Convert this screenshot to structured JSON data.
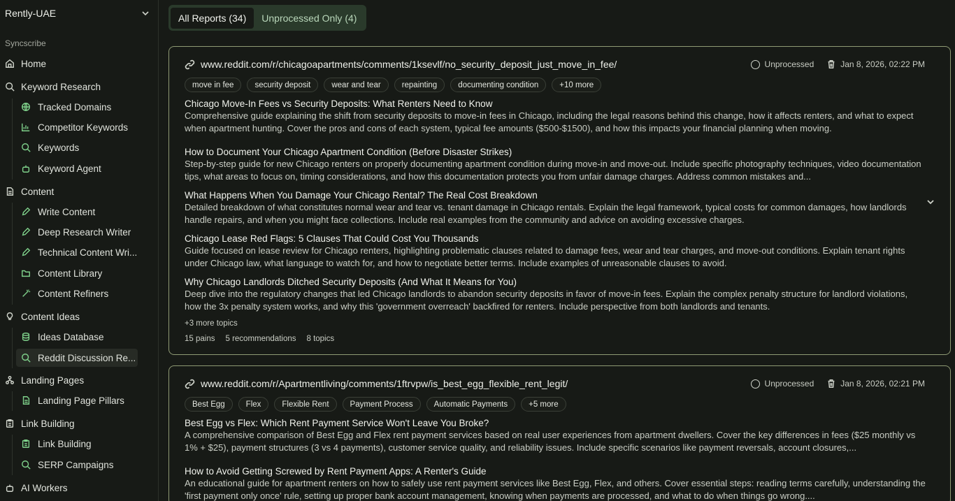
{
  "sidebar": {
    "workspace": "Rently-UAE",
    "section": "Syncscribe",
    "home": "Home",
    "keyword_research": {
      "label": "Keyword Research",
      "items": [
        "Tracked Domains",
        "Competitor Keywords",
        "Keywords",
        "Keyword Agent"
      ]
    },
    "content": {
      "label": "Content",
      "items": [
        "Write Content",
        "Deep Research Writer",
        "Technical Content Wri...",
        "Content Library",
        "Content Refiners"
      ]
    },
    "content_ideas": {
      "label": "Content Ideas",
      "items": [
        "Ideas Database",
        "Reddit Discussion Re..."
      ]
    },
    "landing_pages": {
      "label": "Landing Pages",
      "items": [
        "Landing Page Pillars"
      ]
    },
    "link_building": {
      "label": "Link Building",
      "items": [
        "Link Building",
        "SERP Campaigns"
      ]
    },
    "ai_workers": "AI Workers"
  },
  "tabs": {
    "all": "All Reports (34)",
    "unprocessed": "Unprocessed Only (4)"
  },
  "reports": [
    {
      "url": "www.reddit.com/r/chicagoapartments/comments/1ksevlf/no_security_deposit_just_move_in_fee/",
      "status": "Unprocessed",
      "date": "Jan 8, 2026, 02:22 PM",
      "tags": [
        "move in fee",
        "security deposit",
        "wear and tear",
        "repainting",
        "documenting condition",
        "+10 more"
      ],
      "topics": [
        {
          "title": "Chicago Move-In Fees vs Security Deposits: What Renters Need to Know",
          "desc": "Comprehensive guide explaining the shift from security deposits to move-in fees in Chicago, including the legal reasons behind this change, how it affects renters, and what to expect when apartment hunting. Cover the pros and cons of each system, typical fee amounts ($500-$1500), and how this impacts your financial planning when moving."
        },
        {
          "title": "How to Document Your Chicago Apartment Condition (Before Disaster Strikes)",
          "desc": "Step-by-step guide for new Chicago renters on properly documenting apartment condition during move-in and move-out. Include specific photography techniques, video documentation tips, what areas to focus on, timing considerations, and how this documentation protects you from unfair damage charges. Address common mistakes and..."
        },
        {
          "title": "What Happens When You Damage Your Chicago Rental? The Real Cost Breakdown",
          "desc": "Detailed breakdown of what constitutes normal wear and tear vs. tenant damage in Chicago rentals. Explain the legal framework, typical costs for common damages, how landlords handle repairs, and when you might face collections. Include real examples from the community and advice on avoiding excessive charges."
        },
        {
          "title": "Chicago Lease Red Flags: 5 Clauses That Could Cost You Thousands",
          "desc": "Guide focused on lease review for Chicago renters, highlighting problematic clauses related to damage fees, wear and tear charges, and move-out conditions. Explain tenant rights under Chicago law, what language to watch for, and how to negotiate better terms. Include examples of unreasonable clauses to avoid."
        },
        {
          "title": "Why Chicago Landlords Ditched Security Deposits (And What It Means for You)",
          "desc": "Deep dive into the regulatory changes that led Chicago landlords to abandon security deposits in favor of move-in fees. Explain the complex penalty structure for landlord violations, how the 3x penalty system works, and why this 'government overreach' backfired for renters. Include perspective from both landlords and tenants."
        }
      ],
      "more_topics": "+3 more topics",
      "stats": [
        "15 pains",
        "5 recommendations",
        "8 topics"
      ]
    },
    {
      "url": "www.reddit.com/r/Apartmentliving/comments/1ftrvpw/is_best_egg_flexible_rent_legit/",
      "status": "Unprocessed",
      "date": "Jan 8, 2026, 02:21 PM",
      "tags": [
        "Best Egg",
        "Flex",
        "Flexible Rent",
        "Payment Process",
        "Automatic Payments",
        "+5 more"
      ],
      "topics": [
        {
          "title": "Best Egg vs Flex: Which Rent Payment Service Won't Leave You Broke?",
          "desc": "A comprehensive comparison of Best Egg and Flex rent payment services based on real user experiences from apartment dwellers. Cover the key differences in fees ($25 monthly vs 1% + $25), payment structures (3 vs 4 payments), customer service quality, and reliability issues. Include specific scenarios like payment reversals, account closures,..."
        },
        {
          "title": "How to Avoid Getting Screwed by Rent Payment Apps: A Renter's Guide",
          "desc": "An educational guide for apartment renters on how to safely use rent payment services like Best Egg, Flex, and others. Cover essential steps: reading terms carefully, understanding the 'first payment only once' rule, setting up proper bank account management, knowing when payments are processed, and what to do when things go wrong...."
        }
      ]
    }
  ]
}
